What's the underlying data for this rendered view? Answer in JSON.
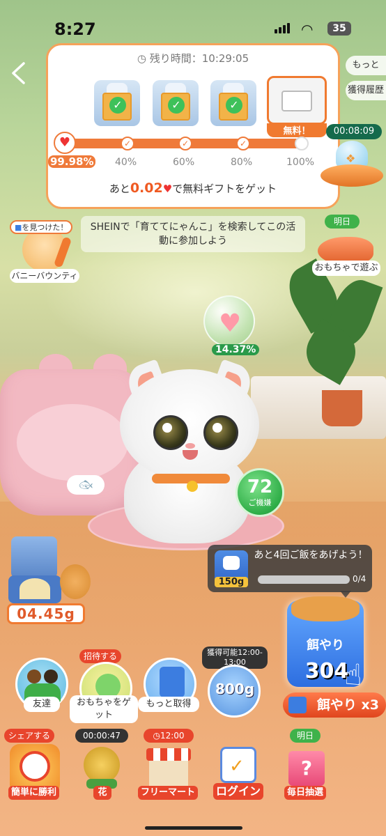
{
  "status_bar": {
    "time": "8:27",
    "battery": "35"
  },
  "card": {
    "timer_label": "残り時間：10:29:05",
    "gifts": [
      {
        "state": "claimed"
      },
      {
        "state": "claimed"
      },
      {
        "state": "claimed"
      }
    ],
    "prize_tag": "無料！",
    "progress_percent": 99.98,
    "progress_label": "99.98%",
    "milestones": [
      "40%",
      "60%",
      "80%",
      "100%"
    ],
    "goal_prefix": "あと",
    "goal_amount": "0.02",
    "goal_suffix": "で無料ギフトをゲット"
  },
  "side": {
    "more": "もっと",
    "history": "獲得履歴"
  },
  "ufo": {
    "timer": "00:08:09"
  },
  "hint": "SHEINで「育ててにゃんこ」を検索してこの活動に参加しよう",
  "bunny": {
    "badge": "を見つけた！",
    "label": "バニーバウンティ"
  },
  "fish": {
    "badge": "明日",
    "label": "おもちゃで遊ぶ"
  },
  "bubble": {
    "percent": "14.37%"
  },
  "mood": {
    "value": "72",
    "label": "ご機嫌"
  },
  "feeder": {
    "counter": "04.45g"
  },
  "task": {
    "amount": "150g",
    "text": "あと4回ご飯をあげよう！",
    "count": "0/4",
    "progress": 0
  },
  "feed": {
    "bag_name": "餌やり",
    "count": "304",
    "button": "餌やり x3"
  },
  "circles": {
    "friends": {
      "label": "友達"
    },
    "toy": {
      "badge": "招待する",
      "label": "おもちゃをゲット"
    },
    "more": {
      "label": "もっと取得"
    },
    "food": {
      "badge": "獲得可能12:00-13:00",
      "amount": "800g"
    }
  },
  "bottom": {
    "win": {
      "badge": "シェアする",
      "label": "簡単に勝利"
    },
    "flower": {
      "badge": "00:00:47",
      "label": "花"
    },
    "market": {
      "badge": "12:00",
      "label": "フリーマート"
    },
    "login": {
      "label": "ログイン"
    },
    "lottery": {
      "badge": "明日",
      "label": "毎日抽選"
    }
  },
  "colors": {
    "accent": "#ef7a3a",
    "green": "#3fb24a",
    "red": "#e8452c"
  }
}
